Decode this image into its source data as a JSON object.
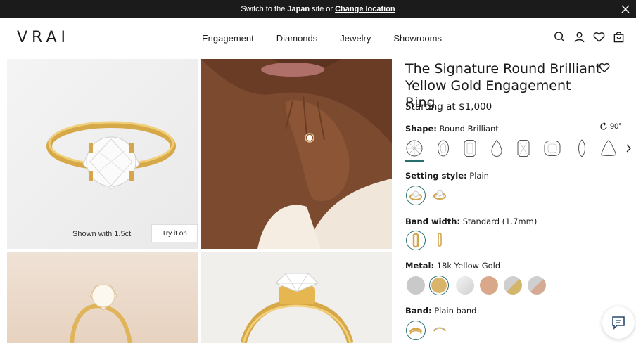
{
  "topbar": {
    "prefix": "Switch to the",
    "country": "Japan",
    "middle": "site or",
    "change_link": "Change location"
  },
  "header": {
    "logo": "VRAI",
    "nav": [
      "Engagement",
      "Diamonds",
      "Jewelry",
      "Showrooms"
    ],
    "icons": [
      "search-icon",
      "account-icon",
      "wishlist-heart-icon",
      "bag-icon"
    ]
  },
  "gallery": {
    "shown_with": "Shown with 1.5ct",
    "try_on": "Try it on"
  },
  "product": {
    "title_line1": "The Signature Round Brilliant",
    "title_line2": "Yellow Gold Engagement Ring",
    "price": "Starting at $1,000",
    "rotate": "90°",
    "shape_label": "Shape:",
    "shape_value": "Round Brilliant",
    "shapes": [
      "round",
      "oval",
      "emerald",
      "pear",
      "radiant",
      "cushion",
      "marquise",
      "trillion"
    ],
    "setting_label": "Setting style:",
    "setting_value": "Plain",
    "band_width_label": "Band width:",
    "band_width_value": "Standard (1.7mm)",
    "metal_label": "Metal:",
    "metal_value": "18k Yellow Gold",
    "metals": [
      {
        "name": "platinum",
        "color": "#c9c9c9"
      },
      {
        "name": "18k-yellow-gold",
        "color": "#d9b46a"
      },
      {
        "name": "white-gold",
        "color": "#e2e2e2"
      },
      {
        "name": "rose-gold",
        "color": "#d9a88a"
      },
      {
        "name": "yellow-platinum",
        "color": "#d4b56d"
      },
      {
        "name": "rose-platinum",
        "color": "#d6aa92"
      }
    ],
    "band_label": "Band:",
    "band_value": "Plain band"
  },
  "colors": {
    "accent": "#2a6f6f",
    "topbar": "#1b1b1b"
  }
}
